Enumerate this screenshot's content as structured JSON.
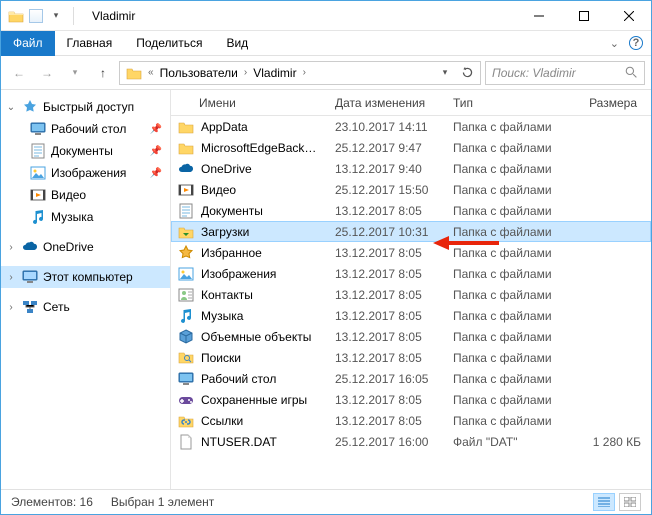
{
  "title": "Vladimir",
  "ribbon": {
    "file": "Файл",
    "tabs": [
      "Главная",
      "Поделиться",
      "Вид"
    ]
  },
  "breadcrumb": {
    "segments": [
      "Пользователи",
      "Vladimir"
    ]
  },
  "search": {
    "placeholder": "Поиск: Vladimir"
  },
  "nav": {
    "quick_access": "Быстрый доступ",
    "items": [
      {
        "label": "Рабочий стол",
        "icon": "desktop",
        "pinned": true
      },
      {
        "label": "Документы",
        "icon": "docs",
        "pinned": true
      },
      {
        "label": "Изображения",
        "icon": "pictures",
        "pinned": true
      },
      {
        "label": "Видео",
        "icon": "video",
        "pinned": false
      },
      {
        "label": "Музыка",
        "icon": "music",
        "pinned": false
      }
    ],
    "onedrive": "OneDrive",
    "this_pc": "Этот компьютер",
    "network": "Сеть"
  },
  "columns": {
    "name": "Имени",
    "date": "Дата изменения",
    "type": "Тип",
    "size": "Размера"
  },
  "rows": [
    {
      "name": "AppData",
      "date": "23.10.2017 14:11",
      "type": "Папка с файлами",
      "size": "",
      "icon": "folder"
    },
    {
      "name": "MicrosoftEdgeBackups",
      "date": "25.12.2017 9:47",
      "type": "Папка с файлами",
      "size": "",
      "icon": "folder"
    },
    {
      "name": "OneDrive",
      "date": "13.12.2017 9:40",
      "type": "Папка с файлами",
      "size": "",
      "icon": "onedrive"
    },
    {
      "name": "Видео",
      "date": "25.12.2017 15:50",
      "type": "Папка с файлами",
      "size": "",
      "icon": "video"
    },
    {
      "name": "Документы",
      "date": "13.12.2017 8:05",
      "type": "Папка с файлами",
      "size": "",
      "icon": "docs"
    },
    {
      "name": "Загрузки",
      "date": "25.12.2017 10:31",
      "type": "Папка с файлами",
      "size": "",
      "icon": "downloads",
      "selected": true
    },
    {
      "name": "Избранное",
      "date": "13.12.2017 8:05",
      "type": "Папка с файлами",
      "size": "",
      "icon": "favorites"
    },
    {
      "name": "Изображения",
      "date": "13.12.2017 8:05",
      "type": "Папка с файлами",
      "size": "",
      "icon": "pictures"
    },
    {
      "name": "Контакты",
      "date": "13.12.2017 8:05",
      "type": "Папка с файлами",
      "size": "",
      "icon": "contacts"
    },
    {
      "name": "Музыка",
      "date": "13.12.2017 8:05",
      "type": "Папка с файлами",
      "size": "",
      "icon": "music"
    },
    {
      "name": "Объемные объекты",
      "date": "13.12.2017 8:05",
      "type": "Папка с файлами",
      "size": "",
      "icon": "3d"
    },
    {
      "name": "Поиски",
      "date": "13.12.2017 8:05",
      "type": "Папка с файлами",
      "size": "",
      "icon": "search"
    },
    {
      "name": "Рабочий стол",
      "date": "25.12.2017 16:05",
      "type": "Папка с файлами",
      "size": "",
      "icon": "desktop"
    },
    {
      "name": "Сохраненные игры",
      "date": "13.12.2017 8:05",
      "type": "Папка с файлами",
      "size": "",
      "icon": "games"
    },
    {
      "name": "Ссылки",
      "date": "13.12.2017 8:05",
      "type": "Папка с файлами",
      "size": "",
      "icon": "links"
    },
    {
      "name": "NTUSER.DAT",
      "date": "25.12.2017 16:00",
      "type": "Файл \"DAT\"",
      "size": "1 280 КБ",
      "icon": "file"
    }
  ],
  "status": {
    "count_label": "Элементов:",
    "count": "16",
    "selection": "Выбран 1 элемент"
  }
}
